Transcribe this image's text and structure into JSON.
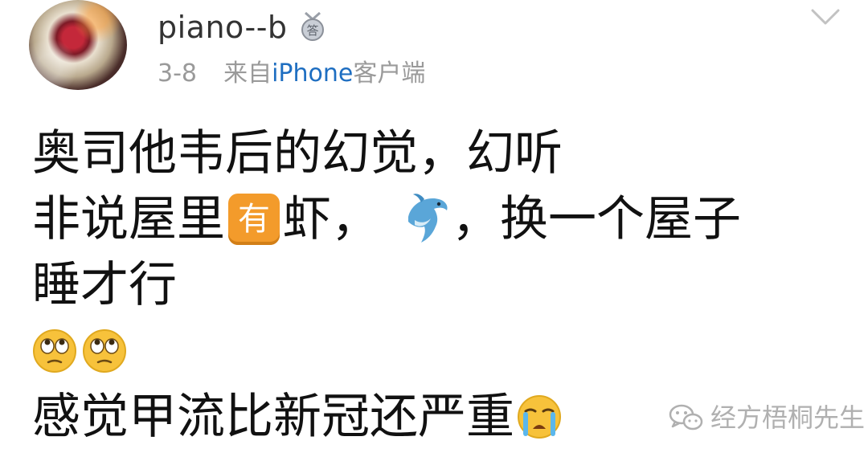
{
  "post": {
    "username": "piano--b",
    "medal_label": "答",
    "date": "3-8",
    "source_prefix": "来自",
    "source_device": "iPhone",
    "source_suffix": "客户端",
    "lines": {
      "l1": "奥司他韦后的幻觉，幻听",
      "l2a": "非说屋里",
      "you_badge": "有",
      "l2b": "虾，",
      "l2c": "，换一个屋子",
      "l3": "睡才行",
      "l5": "感觉甲流比新冠还严重"
    },
    "icons": [
      "avatar",
      "medal-icon",
      "chevron-down-icon",
      "dolphin-emoji",
      "rolling-eyes-emoji",
      "crying-face-emoji",
      "wechat-icon"
    ]
  },
  "watermark": {
    "text": "经方梧桐先生"
  },
  "colors": {
    "username": "#333333",
    "meta": "#9a9a9a",
    "link": "#1e6ec1",
    "body": "#111111",
    "badge": "#f39b2b"
  }
}
